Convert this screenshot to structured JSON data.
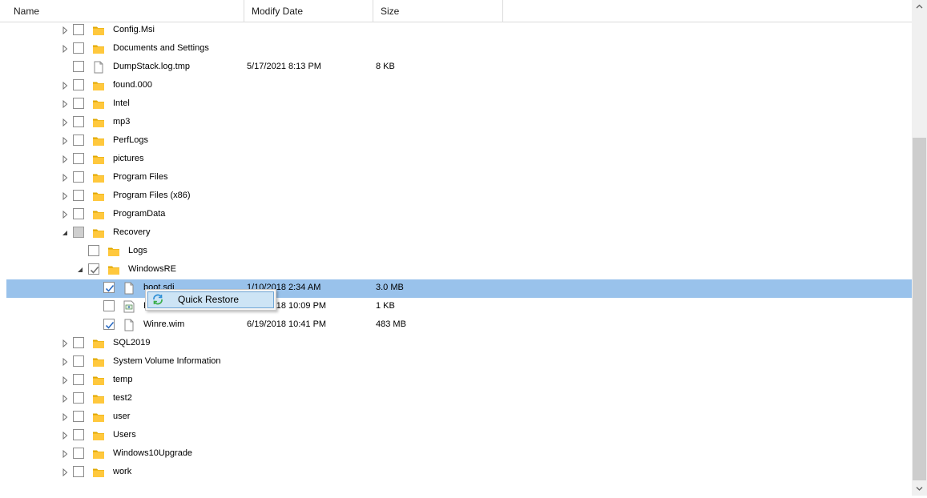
{
  "columns": {
    "name": "Name",
    "modify_date": "Modify Date",
    "size": "Size"
  },
  "rows": [
    {
      "name": "Config.Msi",
      "type": "folder",
      "level": 0,
      "expander": "collapsed",
      "check": "none",
      "date": "",
      "size": ""
    },
    {
      "name": "Documents and Settings",
      "type": "folder",
      "level": 0,
      "expander": "collapsed",
      "check": "none",
      "date": "",
      "size": ""
    },
    {
      "name": "DumpStack.log.tmp",
      "type": "file",
      "level": 0,
      "expander": "none",
      "check": "none",
      "date": "5/17/2021 8:13 PM",
      "size": "8 KB"
    },
    {
      "name": "found.000",
      "type": "folder",
      "level": 0,
      "expander": "collapsed",
      "check": "none",
      "date": "",
      "size": ""
    },
    {
      "name": "Intel",
      "type": "folder",
      "level": 0,
      "expander": "collapsed",
      "check": "none",
      "date": "",
      "size": ""
    },
    {
      "name": "mp3",
      "type": "folder",
      "level": 0,
      "expander": "collapsed",
      "check": "none",
      "date": "",
      "size": ""
    },
    {
      "name": "PerfLogs",
      "type": "folder",
      "level": 0,
      "expander": "collapsed",
      "check": "none",
      "date": "",
      "size": ""
    },
    {
      "name": "pictures",
      "type": "folder",
      "level": 0,
      "expander": "collapsed",
      "check": "none",
      "date": "",
      "size": ""
    },
    {
      "name": "Program Files",
      "type": "folder",
      "level": 0,
      "expander": "collapsed",
      "check": "none",
      "date": "",
      "size": ""
    },
    {
      "name": "Program Files (x86)",
      "type": "folder",
      "level": 0,
      "expander": "collapsed",
      "check": "none",
      "date": "",
      "size": ""
    },
    {
      "name": "ProgramData",
      "type": "folder",
      "level": 0,
      "expander": "collapsed",
      "check": "none",
      "date": "",
      "size": ""
    },
    {
      "name": "Recovery",
      "type": "folder",
      "level": 0,
      "expander": "expanded",
      "check": "partial",
      "date": "",
      "size": ""
    },
    {
      "name": "Logs",
      "type": "folder",
      "level": 1,
      "expander": "none",
      "check": "none",
      "date": "",
      "size": ""
    },
    {
      "name": "WindowsRE",
      "type": "folder",
      "level": 1,
      "expander": "expanded",
      "check": "checked-grey",
      "date": "",
      "size": ""
    },
    {
      "name": "boot.sdi",
      "type": "file",
      "level": 2,
      "expander": "none",
      "check": "checked",
      "date": "1/10/2018 2:34 AM",
      "size": "3.0 MB",
      "selected": true
    },
    {
      "name": "ReAgent.xml",
      "type": "xml",
      "level": 2,
      "expander": "none",
      "check": "none",
      "date": "6/19/2018 10:09 PM",
      "size": "1 KB"
    },
    {
      "name": "Winre.wim",
      "type": "file",
      "level": 2,
      "expander": "none",
      "check": "checked",
      "date": "6/19/2018 10:41 PM",
      "size": "483 MB"
    },
    {
      "name": "SQL2019",
      "type": "folder",
      "level": 0,
      "expander": "collapsed",
      "check": "none",
      "date": "",
      "size": ""
    },
    {
      "name": "System Volume Information",
      "type": "folder",
      "level": 0,
      "expander": "collapsed",
      "check": "none",
      "date": "",
      "size": ""
    },
    {
      "name": "temp",
      "type": "folder",
      "level": 0,
      "expander": "collapsed",
      "check": "none",
      "date": "",
      "size": ""
    },
    {
      "name": "test2",
      "type": "folder",
      "level": 0,
      "expander": "collapsed",
      "check": "none",
      "date": "",
      "size": ""
    },
    {
      "name": "user",
      "type": "folder",
      "level": 0,
      "expander": "collapsed",
      "check": "none",
      "date": "",
      "size": ""
    },
    {
      "name": "Users",
      "type": "folder",
      "level": 0,
      "expander": "collapsed",
      "check": "none",
      "date": "",
      "size": ""
    },
    {
      "name": "Windows10Upgrade",
      "type": "folder",
      "level": 0,
      "expander": "collapsed",
      "check": "none",
      "date": "",
      "size": ""
    },
    {
      "name": "work",
      "type": "folder",
      "level": 0,
      "expander": "collapsed",
      "check": "none",
      "date": "",
      "size": ""
    }
  ],
  "context_menu": {
    "items": [
      {
        "label": "Quick Restore",
        "icon": "restore-icon"
      }
    ]
  },
  "colors": {
    "selection": "#99c2eb",
    "folder": "#ffc83d",
    "menu_highlight": "#cde4f5"
  }
}
